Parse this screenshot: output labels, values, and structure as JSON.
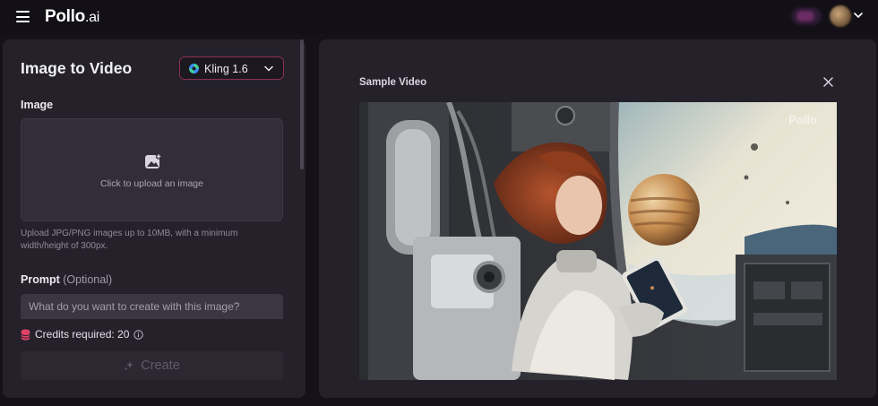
{
  "header": {
    "logo_main": "Pollo",
    "logo_suffix": ".ai"
  },
  "left_panel": {
    "title": "Image to Video",
    "model_select": {
      "value": "Kling 1.6"
    },
    "image_section_label": "Image",
    "upload_text": "Click to upload an image",
    "help_text": "Upload JPG/PNG images up to 10MB, with a minimum width/height of 300px.",
    "prompt_label": "Prompt",
    "prompt_optional": "(Optional)",
    "prompt_placeholder": "What do you want to create with this image?",
    "credits_text": "Credits required: 20",
    "create_label": "Create"
  },
  "right_panel": {
    "title": "Sample Video",
    "watermark": "Pollo"
  },
  "colors": {
    "accent_border": "#8b2f4e",
    "credits_icon": "#e0446a",
    "model_icon_green": "#3fd49a",
    "model_icon_blue": "#3b8cff"
  },
  "icons": {
    "menu": "hamburger-icon",
    "avatar_chevron": "chevron-down-icon",
    "model": "kling-logo-icon",
    "upload": "image-add-icon",
    "credits": "coins-icon",
    "info": "info-icon",
    "create": "sparkle-icon",
    "close": "close-icon"
  }
}
